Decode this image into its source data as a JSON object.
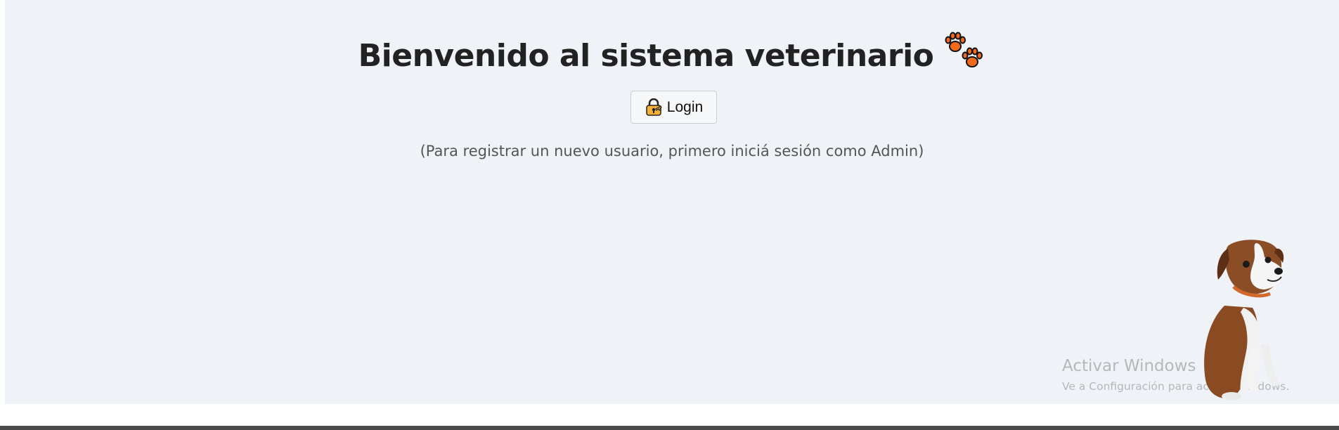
{
  "page": {
    "title": "Bienvenido al sistema veterinario",
    "title_icon": "paw-prints-icon",
    "hint": "(Para registrar un nuevo usuario, primero iniciá sesión como Admin)"
  },
  "login": {
    "label": "Login",
    "icon": "lock-key-icon"
  },
  "mascot": {
    "icon": "boxer-puppy-image"
  },
  "watermark": {
    "title": "Activar Windows",
    "subtitle": "Ve a Configuración para activar Windows."
  },
  "colors": {
    "background": "#eff2f7",
    "title": "#222222",
    "paw": "#f26b1d",
    "lock": "#f2b134"
  }
}
